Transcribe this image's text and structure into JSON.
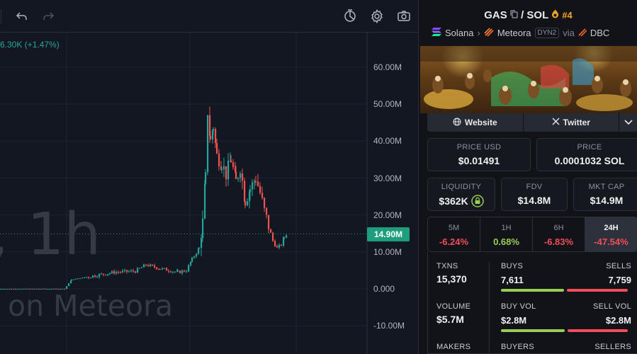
{
  "chart": {
    "pct_readout": "6.30K (+1.47%)",
    "watermark_interval": ", 1h",
    "watermark_sub": ") on Meteora",
    "current_price_label": "14.90M",
    "y_ticks": [
      "60.00M",
      "50.00M",
      "40.00M",
      "30.00M",
      "20.00M",
      "10.00M",
      "0.000",
      "-10.00M"
    ],
    "up_color": "#26a69a",
    "down_color": "#ef5350"
  },
  "toolbar": {
    "icons": [
      "undo-icon",
      "redo-icon",
      "indicator-icon",
      "settings-icon",
      "camera-icon"
    ]
  },
  "pair": {
    "base": "GAS",
    "slash": "/",
    "quote": "SOL",
    "rank": "#4"
  },
  "chain": {
    "name": "Solana",
    "dex": "Meteora",
    "dex_tag": "DYN2",
    "via": "via",
    "via_name": "DBC"
  },
  "links": {
    "website": "Website",
    "twitter": "Twitter"
  },
  "stats": {
    "price_usd_label": "PRICE USD",
    "price_usd": "$0.01491",
    "price_label": "PRICE",
    "price_sol": "0.0001032 SOL",
    "liquidity_label": "LIQUIDITY",
    "liquidity": "$362K",
    "fdv_label": "FDV",
    "fdv": "$14.8M",
    "mktcap_label": "MKT CAP",
    "mktcap": "$14.9M"
  },
  "timeframes": [
    {
      "label": "5M",
      "value": "-6.24%"
    },
    {
      "label": "1H",
      "value": "0.68%"
    },
    {
      "label": "6H",
      "value": "-6.83%"
    },
    {
      "label": "24H",
      "value": "-47.54%"
    }
  ],
  "txns": {
    "txns_label": "TXNS",
    "txns": "15,370",
    "buys_label": "BUYS",
    "buys": "7,611",
    "sells_label": "SELLS",
    "sells": "7,759",
    "buy_fraction": 0.495,
    "volume_label": "VOLUME",
    "volume": "$5.7M",
    "buy_vol_label": "BUY VOL",
    "buy_vol": "$2.8M",
    "sell_vol_label": "SELL VOL",
    "sell_vol": "$2.8M",
    "buy_vol_fraction": 0.5,
    "makers_label": "MAKERS",
    "buyers_label": "BUYERS",
    "sellers_label": "SELLERS"
  }
}
